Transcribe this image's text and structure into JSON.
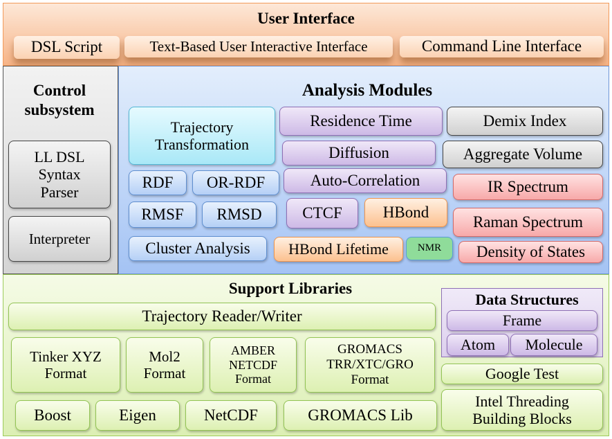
{
  "user_interface": {
    "title": "User Interface",
    "items": [
      "DSL Script",
      "Text-Based User Interactive Interface",
      "Command Line Interface"
    ]
  },
  "control": {
    "title": "Control subsystem",
    "items": [
      "LL DSL Syntax Parser",
      "Interpreter"
    ]
  },
  "analysis": {
    "title": "Analysis Modules",
    "items": [
      "Trajectory Transformation",
      "Residence Time",
      "Demix Index",
      "Diffusion",
      "Aggregate Volume",
      "RDF",
      "OR-RDF",
      "Auto-Correlation",
      "IR Spectrum",
      "RMSF",
      "RMSD",
      "CTCF",
      "HBond",
      "Raman Spectrum",
      "Cluster Analysis",
      "HBond Lifetime",
      "NMR",
      "Density of States"
    ]
  },
  "support": {
    "title": "Support Libraries",
    "items": [
      "Trajectory Reader/Writer",
      "Tinker XYZ Format",
      "Mol2 Format",
      "AMBER NETCDF Format",
      "GROMACS TRR/XTC/GRO Format",
      "Google Test",
      "Intel Threading Building Blocks",
      "Boost",
      "Eigen",
      "NetCDF",
      "GROMACS Lib"
    ]
  },
  "data_structures": {
    "title": "Data Structures",
    "items": [
      "Frame",
      "Atom",
      "Molecule"
    ]
  },
  "colors": {
    "ui": "#f7b487",
    "analysis": "#a4c3f4",
    "support": "#dcefb4",
    "control": "#d4d4d4"
  }
}
